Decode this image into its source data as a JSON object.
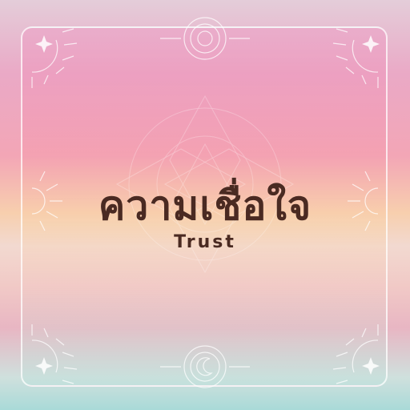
{
  "title": "ความเชื่อใจ",
  "subtitle": "Trust",
  "colors": {
    "text": "#4a2a22",
    "frame": "#ffffff"
  },
  "icons": [
    "sun-icon",
    "sparkle-icon",
    "moon-icon",
    "mandala-icon"
  ]
}
